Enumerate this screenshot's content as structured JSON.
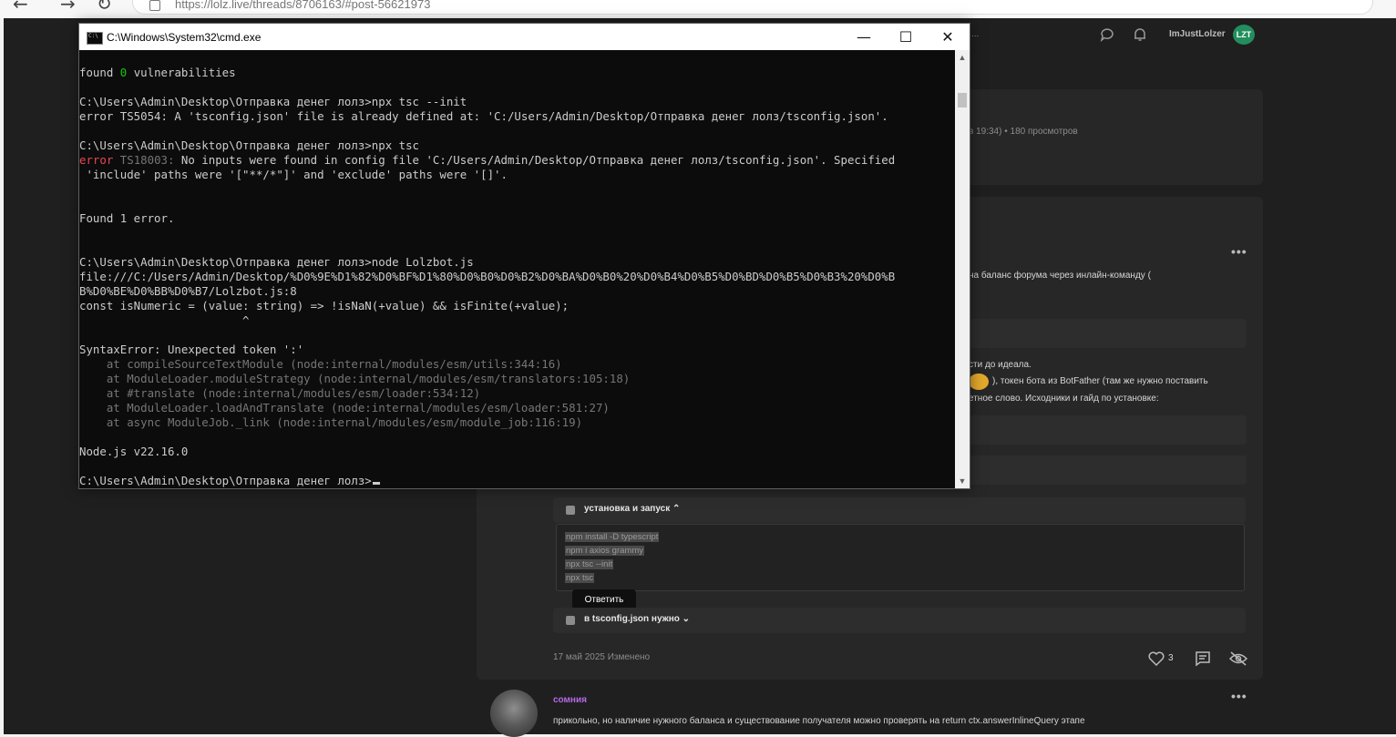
{
  "browser": {
    "url": "https://lolz.live/threads/8706163/#post-56621973"
  },
  "forum": {
    "username": "ImJustLolzer",
    "badge": "LZT",
    "header_search_partial": "...",
    "thread_meta": "в 19:34) • 180 просмотров",
    "post_text_1": "на баланс форума через инлайн-команду (",
    "post_text_2": "сти до идеала.",
    "post_text_3": "), токен бота из BotFather (там же нужно поставить",
    "post_text_4": "етное слово. Исходники и гайд по установке:",
    "spoiler1_title": "установка и запуск ⌃",
    "code_lines": [
      "npm install -D typescript",
      "npm i axios grammy",
      "npx tsc --init",
      "npx tsc"
    ],
    "tooltip": "Ответить",
    "spoiler2_title": "в tsconfig.json нужно ⌄",
    "post_date": "17 май 2025  Изменено",
    "likes": "3",
    "reply_author": "сомния",
    "reply_text": "прикольно, но наличие нужного баланса и существование получателя можно проверять на return ctx.answerInlineQuery этапе",
    "dots": "•••"
  },
  "cmd": {
    "title": "C:\\Windows\\System32\\cmd.exe",
    "minimize": "—",
    "maximize": "☐",
    "close": "✕",
    "lines": {
      "l1a": "found ",
      "l1b": "0",
      "l1c": " vulnerabilities",
      "l2": "C:\\Users\\Admin\\Desktop\\Отправка денег лолз>npx tsc --init",
      "l3": "error TS5054: A 'tsconfig.json' file is already defined at: 'C:/Users/Admin/Desktop/Отправка денег лолз/tsconfig.json'.",
      "l4": "C:\\Users\\Admin\\Desktop\\Отправка денег лолз>npx tsc",
      "l5a": "error",
      "l5b": " TS18003:",
      "l5c": " No inputs were found in config file 'C:/Users/Admin/Desktop/Отправка денег лолз/tsconfig.json'. Specified",
      "l6": " 'include' paths were '[\"**/*\"]' and 'exclude' paths were '[]'.",
      "l7": "Found 1 error.",
      "l8": "C:\\Users\\Admin\\Desktop\\Отправка денег лолз>node Lolzbot.js",
      "l9": "file:///C:/Users/Admin/Desktop/%D0%9E%D1%82%D0%BF%D1%80%D0%B0%D0%B2%D0%BA%D0%B0%20%D0%B4%D0%B5%D0%BD%D0%B5%D0%B3%20%D0%B",
      "l10": "B%D0%BE%D0%BB%D0%B7/Lolzbot.js:8",
      "l11": "const isNumeric = (value: string) => !isNaN(+value) && isFinite(+value);",
      "l12": "                        ^",
      "l13": "SyntaxError: Unexpected token ':'",
      "l14": "    at compileSourceTextModule (node:internal/modules/esm/utils:344:16)",
      "l15": "    at ModuleLoader.moduleStrategy (node:internal/modules/esm/translators:105:18)",
      "l16": "    at #translate (node:internal/modules/esm/loader:534:12)",
      "l17": "    at ModuleLoader.loadAndTranslate (node:internal/modules/esm/loader:581:27)",
      "l18": "    at async ModuleJob._link (node:internal/modules/esm/module_job:116:19)",
      "l19": "Node.js v22.16.0",
      "l20": "C:\\Users\\Admin\\Desktop\\Отправка денег лолз>"
    }
  }
}
